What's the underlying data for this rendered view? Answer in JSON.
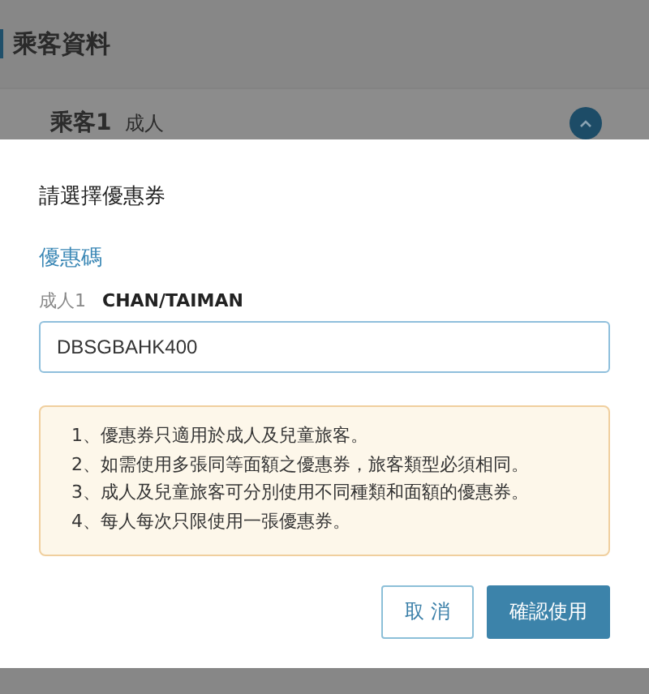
{
  "page": {
    "title": "乘客資料",
    "passenger": {
      "label": "乘客1",
      "type": "成人",
      "expanded": true
    }
  },
  "dialog": {
    "title": "請選擇優惠券",
    "section": "優惠碼",
    "passenger_type": "成人1",
    "passenger_name": "CHAN/TAIMAN",
    "coupon_field": {
      "value": "DBSGBAHK400"
    },
    "notes": [
      "1、優惠券只適用於成人及兒童旅客。",
      "2、如需使用多張同等面額之優惠券，旅客類型必須相同。",
      "3、成人及兒童旅客可分別使用不同種類和面額的優惠券。",
      "4、每人每次只限使用一張優惠券。"
    ],
    "buttons": [
      {
        "label": "取 消",
        "kind": "secondary"
      },
      {
        "label": "確認使用",
        "kind": "primary"
      }
    ]
  }
}
